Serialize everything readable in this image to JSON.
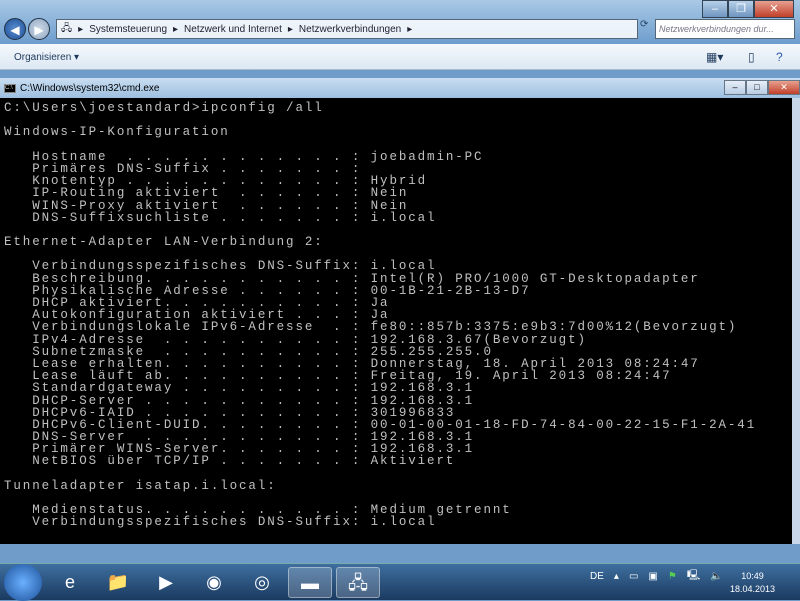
{
  "explorer": {
    "breadcrumb": [
      "Systemsteuerung",
      "Netzwerk und Internet",
      "Netzwerkverbindungen"
    ],
    "search_placeholder": "Netzwerkverbindungen dur...",
    "organize_label": "Organisieren ▾"
  },
  "cmd": {
    "title": "C:\\Windows\\system32\\cmd.exe",
    "lines": [
      "C:\\Users\\joestandard>ipconfig /all",
      "",
      "Windows-IP-Konfiguration",
      "",
      "   Hostname  . . . . . . . . . . . . : joebadmin-PC",
      "   Primäres DNS-Suffix . . . . . . . :",
      "   Knotentyp . . . . . . . . . . . . : Hybrid",
      "   IP-Routing aktiviert  . . . . . . : Nein",
      "   WINS-Proxy aktiviert  . . . . . . : Nein",
      "   DNS-Suffixsuchliste . . . . . . . : i.local",
      "",
      "Ethernet-Adapter LAN-Verbindung 2:",
      "",
      "   Verbindungsspezifisches DNS-Suffix: i.local",
      "   Beschreibung. . . . . . . . . . . : Intel(R) PRO/1000 GT-Desktopadapter",
      "   Physikalische Adresse . . . . . . : 00-1B-21-2B-13-D7",
      "   DHCP aktiviert. . . . . . . . . . : Ja",
      "   Autokonfiguration aktiviert . . . : Ja",
      "   Verbindungslokale IPv6-Adresse  . : fe80::857b:3375:e9b3:7d00%12(Bevorzugt)",
      "   IPv4-Adresse  . . . . . . . . . . : 192.168.3.67(Bevorzugt)",
      "   Subnetzmaske  . . . . . . . . . . : 255.255.255.0",
      "   Lease erhalten. . . . . . . . . . : Donnerstag, 18. April 2013 08:24:47",
      "   Lease läuft ab. . . . . . . . . . : Freitag, 19. April 2013 08:24:47",
      "   Standardgateway . . . . . . . . . : 192.168.3.1",
      "   DHCP-Server . . . . . . . . . . . : 192.168.3.1",
      "   DHCPv6-IAID . . . . . . . . . . . : 301996833",
      "   DHCPv6-Client-DUID. . . . . . . . : 00-01-00-01-18-FD-74-84-00-22-15-F1-2A-41",
      "   DNS-Server  . . . . . . . . . . . : 192.168.3.1",
      "   Primärer WINS-Server. . . . . . . : 192.168.3.1",
      "   NetBIOS über TCP/IP . . . . . . . : Aktiviert",
      "",
      "Tunneladapter isatap.i.local:",
      "",
      "   Medienstatus. . . . . . . . . . . : Medium getrennt",
      "   Verbindungsspezifisches DNS-Suffix: i.local"
    ]
  },
  "taskbar": {
    "language": "DE",
    "time": "10:49",
    "date": "18.04.2013"
  }
}
